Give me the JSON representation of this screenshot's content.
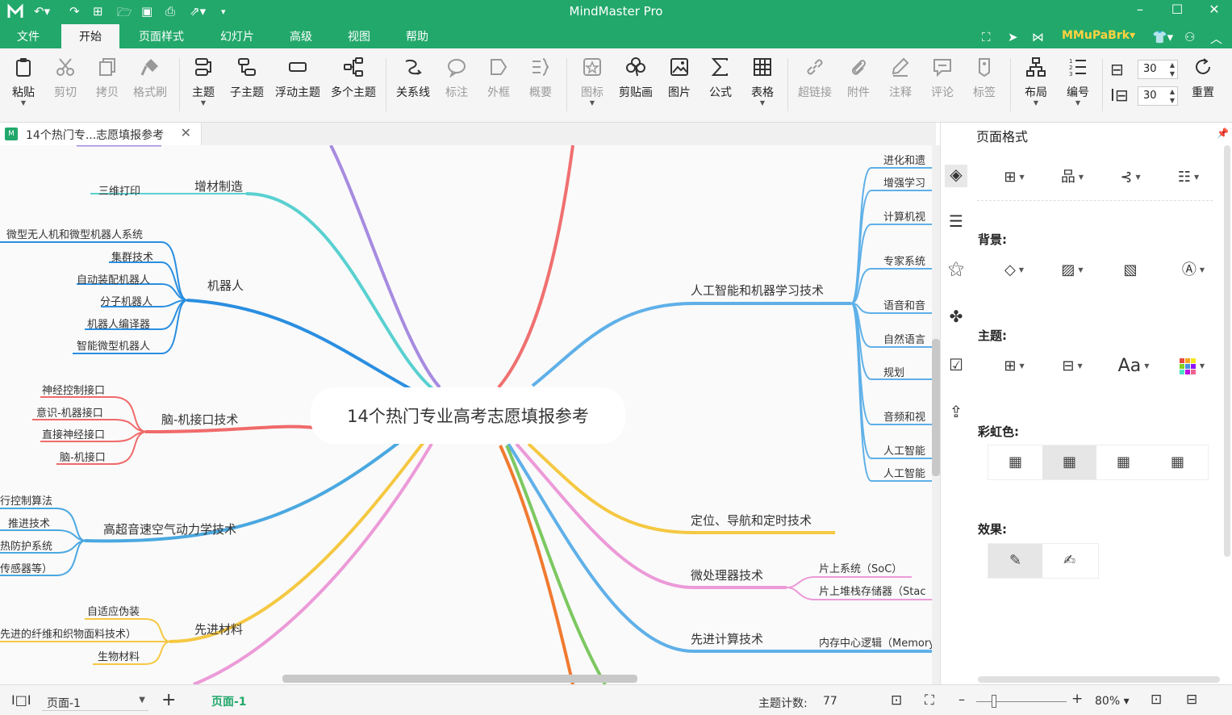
{
  "app": {
    "title": "MindMaster Pro",
    "user": "MMuPaBrk",
    "accent_color": "#22a86b",
    "user_color": "#ffd23f"
  },
  "menus": [
    "文件",
    "开始",
    "页面样式",
    "幻灯片",
    "高级",
    "视图",
    "帮助"
  ],
  "ribbon": {
    "paste": "粘贴",
    "cut": "剪切",
    "copy": "拷贝",
    "format_painter": "格式刷",
    "topic": "主题",
    "subtopic": "子主题",
    "floating_topic": "浮动主题",
    "multi_topic": "多个主题",
    "relation": "关系线",
    "callout": "标注",
    "boundary": "外框",
    "summary": "概要",
    "icon": "图标",
    "clipart": "剪贴画",
    "image": "图片",
    "formula": "公式",
    "table": "表格",
    "hyperlink": "超链接",
    "attachment": "附件",
    "note": "注释",
    "comment": "评论",
    "tag": "标签",
    "layout": "布局",
    "numbering": "编号",
    "spacing_h": "30",
    "spacing_v": "30",
    "reset": "重置"
  },
  "document": {
    "tab_title": "14个热门专...志愿填报参考",
    "tab_icon": "M"
  },
  "mindmap": {
    "central": "14个热门专业高考志愿填报参考",
    "branches": [
      {
        "label": "增材制造",
        "color": "#5ad0d0",
        "children": [
          "三维打印"
        ]
      },
      {
        "label": "机器人",
        "color": "#2a8ee0",
        "children": [
          "微型无人机和微型机器人系统",
          "集群技术",
          "自动装配机器人",
          "分子机器人",
          "机器人编译器",
          "智能微型机器人"
        ]
      },
      {
        "label": "脑-机接口技术",
        "color": "#f06a6a",
        "children": [
          "神经控制接口",
          "意识-机器接口",
          "直接神经接口",
          "脑-机接口"
        ]
      },
      {
        "label": "高超音速空气动力学技术",
        "color": "#4aa8e0",
        "children": [
          "行控制算法",
          "推进技术",
          "热防护系统",
          "传感器等）"
        ]
      },
      {
        "label": "先进材料",
        "color": "#f5c842",
        "children": [
          "自适应伪装",
          "先进的纤维和织物面料技术）",
          "生物材料"
        ]
      },
      {
        "label": "人工智能和机器学习技术",
        "color": "#5fb0e8",
        "children": [
          "进化和遗",
          "增强学习",
          "计算机视",
          "专家系统",
          "语音和音",
          "自然语言",
          "规划",
          "音频和视",
          "人工智能",
          "人工智能"
        ]
      },
      {
        "label": "定位、导航和定时技术",
        "color": "#f5c842",
        "children": []
      },
      {
        "label": "微处理器技术",
        "color": "#ec9ad8",
        "children": [
          "片上系统（SoC）",
          "片上堆栈存储器（Stac"
        ]
      },
      {
        "label": "先进计算技术",
        "color": "#5fb0e8",
        "children": [
          "内存中心逻辑（Memory"
        ]
      }
    ]
  },
  "side_panel": {
    "title": "页面格式",
    "background_label": "背景:",
    "theme_label": "主题:",
    "rainbow_label": "彩虹色:",
    "effect_label": "效果:",
    "font_button": "Aa",
    "rainbow_selected": 2
  },
  "status": {
    "page_select": "页面-1",
    "current_page": "页面-1",
    "topic_count_label": "主题计数:",
    "topic_count": "77",
    "zoom": "80%",
    "zoom_level": 0.2
  }
}
